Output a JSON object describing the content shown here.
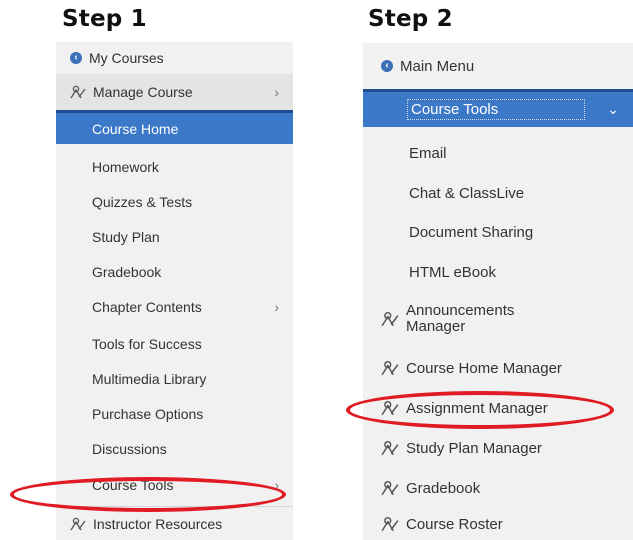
{
  "step1": {
    "title": "Step 1",
    "my_courses": "My Courses",
    "manage_course": "Manage Course",
    "items": [
      "Course Home",
      "Homework",
      "Quizzes & Tests",
      "Study Plan",
      "Gradebook",
      "Chapter Contents",
      "Tools for Success",
      "Multimedia Library",
      "Purchase Options",
      "Discussions",
      "Course Tools"
    ],
    "instructor_resources": "Instructor Resources"
  },
  "step2": {
    "title": "Step 2",
    "main_menu": "Main Menu",
    "course_tools": "Course Tools",
    "items": [
      "Email",
      "Chat & ClassLive",
      "Document Sharing",
      "HTML eBook"
    ],
    "managers": [
      "Announcements Manager",
      "Course Home Manager",
      "Assignment Manager",
      "Study Plan Manager",
      "Gradebook",
      "Course Roster"
    ]
  },
  "colors": {
    "active": "#3b78c7",
    "panel": "#f1f1f1",
    "highlight": "#e01b24",
    "icon": "#3b6fb6"
  },
  "icons": {
    "back": "chevron-left-circle-icon",
    "manage": "user-pencil-icon",
    "expand": "chevron-right-icon",
    "collapse": "chevron-down-icon"
  }
}
